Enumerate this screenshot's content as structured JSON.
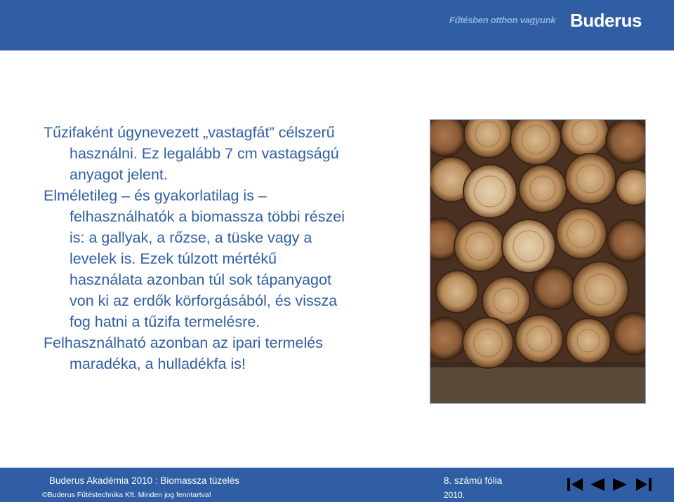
{
  "header": {
    "slogan": "Fűtésben otthon vagyunk",
    "brand": "Buderus",
    "background": "#2f5ea4"
  },
  "content": {
    "paragraphs": [
      {
        "lines": [
          "Tűzifaként  úgynevezett „vastagfát” célszerű",
          "használni. Ez legalább 7 cm vastagságú",
          "anyagot jelent."
        ]
      },
      {
        "lines": [
          "Elméletileg – és gyakorlatilag is –",
          "felhasználhatók a biomassza többi részei",
          "is: a gallyak, a rőzse, a tüske vagy a",
          "levelek is. Ezek túlzott mértékű",
          "használata azonban túl sok tápanyagot",
          "von ki az erdők körforgásából, és vissza",
          "fog hatni a tűzifa termelésre."
        ]
      },
      {
        "lines": [
          "Felhasználható azonban az ipari termelés",
          "maradéka, a hulladékfa is!"
        ]
      }
    ],
    "text_color": "#2f5ea4"
  },
  "photo": {
    "icon": "firewood-stack-photo"
  },
  "footer": {
    "course": "Buderus Akadémia 2010 : Biomassza tüzelés",
    "copyright_symbol": "©",
    "copyright": "Buderus Fűtéstechnika Kft. Minden jog fenntartva!",
    "slide_number": "8. számú fólia",
    "year": "2010.",
    "nav": {
      "first": "first-slide-icon",
      "previous": "previous-slide-icon",
      "next": "next-slide-icon",
      "last": "last-slide-icon"
    }
  }
}
